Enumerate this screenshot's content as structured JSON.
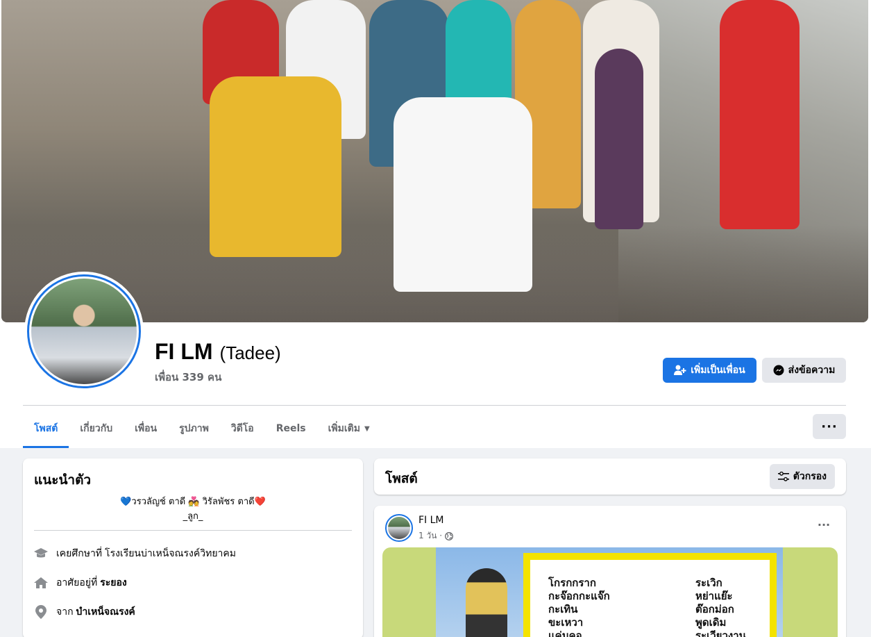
{
  "profile": {
    "name": "FI LM",
    "alternate_name": "(Tadee)",
    "friends_count": "เพื่อน 339 คน"
  },
  "actions": {
    "add_friend": "เพิ่มเป็นเพื่อน",
    "message": "ส่งข้อความ"
  },
  "tabs": [
    {
      "label": "โพสต์",
      "active": true
    },
    {
      "label": "เกี่ยวกับ"
    },
    {
      "label": "เพื่อน"
    },
    {
      "label": "รูปภาพ"
    },
    {
      "label": "วิดีโอ"
    },
    {
      "label": "Reels"
    },
    {
      "label": "เพิ่มเติม"
    }
  ],
  "intro": {
    "title": "แนะนำตัว",
    "bio_line1": "💙วรวลัญช์ ตาดี 💑 วิรัลพัชร ตาดี❤️",
    "bio_line2": "_ลูก_",
    "education_prefix": "เคยศึกษาที่",
    "education_value": "โรงเรียนบ่าเหน็จณรงค์วิทยาคม",
    "lives_prefix": "อาศัยอยู่ที่",
    "lives_value": "ระยอง",
    "from_prefix": "จาก",
    "from_value": "บำเหน็จณรงค์"
  },
  "posts_section": {
    "title": "โพสต์",
    "filter_label": "ตัวกรอง"
  },
  "post": {
    "author": "FI LM",
    "time": "1 วัน ·",
    "image_words_left": "โกรกกราก\nกะจ๊อกกะแจ๊ก\nกะเทิน\nขะเหวา\nแค่มคอ",
    "image_words_right": "ระเวิก\nหย่าแย๊ะ\nต๊อกม่อก\nพูดเดิม\nระเวียวงาน"
  },
  "colors": {
    "accent": "#1b74e4",
    "background": "#f0f2f5",
    "secondary_text": "#65676b"
  }
}
